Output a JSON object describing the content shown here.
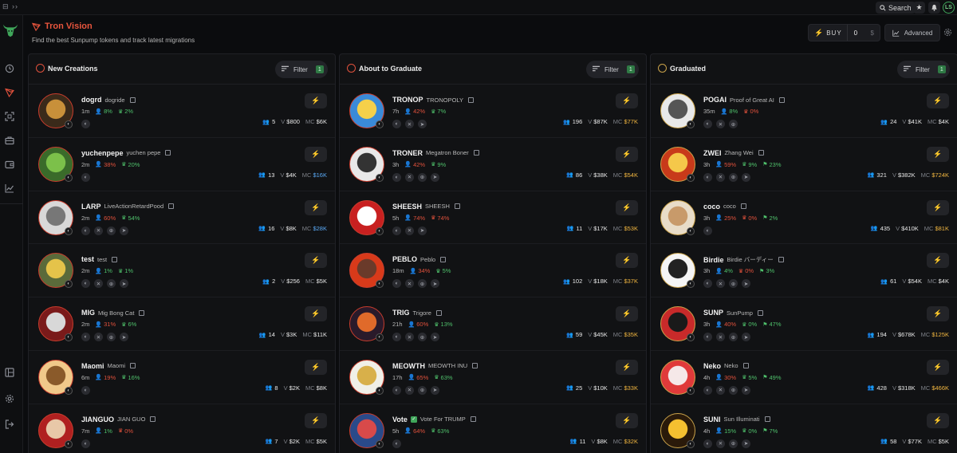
{
  "topbar": {
    "search_label": "Search",
    "avatar_initials": "LS"
  },
  "header": {
    "title": "Tron Vision",
    "subtitle": "Find the best Sunpump tokens and track latest migrations",
    "buy_label": "BUY",
    "buy_value": "0",
    "buy_unit": "$",
    "advanced_label": "Advanced"
  },
  "colors": {
    "accent": "#e0513c",
    "green": "#4fc06b",
    "mc_blue": "#5aa9f5",
    "mc_gold": "#f1b640"
  },
  "columns": [
    {
      "title": "New Creations",
      "filter_label": "Filter",
      "filter_count": "1",
      "tokens": [
        {
          "ticker": "dogrd",
          "name": "dogride",
          "age": "1m",
          "p1": "8%",
          "p1c": "green",
          "p2": "2%",
          "p2c": "green",
          "p3": "",
          "socials": [
            "web"
          ],
          "holders": "5",
          "volume": "$800",
          "mc": "$6K",
          "mcc": "white",
          "bg": "#3a2a1a",
          "fg": "#c8903a",
          "gold": false
        },
        {
          "ticker": "yuchenpepe",
          "name": "yuchen pepe",
          "age": "2m",
          "p1": "38%",
          "p1c": "red",
          "p2": "20%",
          "p2c": "green",
          "p3": "",
          "socials": [
            "web"
          ],
          "holders": "13",
          "volume": "$4K",
          "mc": "$16K",
          "mcc": "blue",
          "bg": "#3a6b2a",
          "fg": "#7cc04a",
          "gold": false
        },
        {
          "ticker": "LARP",
          "name": "LiveActionRetardPood",
          "age": "2m",
          "p1": "60%",
          "p1c": "red",
          "p2": "54%",
          "p2c": "green",
          "p3": "",
          "socials": [
            "web",
            "x",
            "globe",
            "tg"
          ],
          "holders": "16",
          "volume": "$8K",
          "mc": "$28K",
          "mcc": "blue",
          "bg": "#d8d8d8",
          "fg": "#777777",
          "gold": false
        },
        {
          "ticker": "test",
          "name": "test",
          "age": "2m",
          "p1": "1%",
          "p1c": "green",
          "p2": "1%",
          "p2c": "green",
          "p3": "",
          "socials": [
            "web",
            "x",
            "globe",
            "tg"
          ],
          "holders": "2",
          "volume": "$256",
          "mc": "$5K",
          "mcc": "white",
          "bg": "#5a6a3a",
          "fg": "#e5c34a",
          "gold": false
        },
        {
          "ticker": "MIG",
          "name": "Mig Bong Cat",
          "age": "2m",
          "p1": "31%",
          "p1c": "red",
          "p2": "6%",
          "p2c": "green",
          "p3": "",
          "socials": [
            "web",
            "x",
            "globe",
            "tg"
          ],
          "holders": "14",
          "volume": "$3K",
          "mc": "$11K",
          "mcc": "white",
          "bg": "#7a1a1a",
          "fg": "#d8d8d8",
          "gold": false
        },
        {
          "ticker": "Maomi",
          "name": "Maomi",
          "age": "6m",
          "p1": "19%",
          "p1c": "red",
          "p2": "16%",
          "p2c": "green",
          "p3": "",
          "socials": [
            "web"
          ],
          "holders": "8",
          "volume": "$2K",
          "mc": "$8K",
          "mcc": "white",
          "bg": "#f0c98a",
          "fg": "#8a5a2a",
          "gold": false
        },
        {
          "ticker": "JIANGUO",
          "name": "JIAN GUO",
          "age": "7m",
          "p1": "1%",
          "p1c": "green",
          "p2": "0%",
          "p2c": "red",
          "p3": "",
          "socials": [
            "web"
          ],
          "holders": "7",
          "volume": "$2K",
          "mc": "$5K",
          "mcc": "white",
          "bg": "#b02020",
          "fg": "#e8c8a8",
          "gold": false
        }
      ]
    },
    {
      "title": "About to Graduate",
      "filter_label": "Filter",
      "filter_count": "1",
      "tokens": [
        {
          "ticker": "TRONOP",
          "name": "TRONOPOLY",
          "age": "7h",
          "p1": "42%",
          "p1c": "red",
          "p2": "7%",
          "p2c": "green",
          "p3": "",
          "socials": [
            "web",
            "x",
            "tg"
          ],
          "holders": "196",
          "volume": "$87K",
          "mc": "$77K",
          "mcc": "gold",
          "bg": "#3a8ad8",
          "fg": "#f5d04a",
          "gold": false
        },
        {
          "ticker": "TRONER",
          "name": "Megatron Boner",
          "age": "3h",
          "p1": "42%",
          "p1c": "red",
          "p2": "9%",
          "p2c": "green",
          "p3": "",
          "socials": [
            "web",
            "x",
            "globe",
            "tg"
          ],
          "holders": "86",
          "volume": "$38K",
          "mc": "$54K",
          "mcc": "gold",
          "bg": "#e8e8e8",
          "fg": "#333333",
          "gold": false
        },
        {
          "ticker": "SHEESH",
          "name": "SHEESH",
          "age": "5h",
          "p1": "74%",
          "p1c": "red",
          "p2": "74%",
          "p2c": "red",
          "p3": "",
          "socials": [
            "web",
            "x",
            "tg"
          ],
          "holders": "11",
          "volume": "$17K",
          "mc": "$53K",
          "mcc": "gold",
          "bg": "#c82020",
          "fg": "#ffffff",
          "gold": false
        },
        {
          "ticker": "PEBLO",
          "name": "Peblo",
          "age": "18m",
          "p1": "34%",
          "p1c": "red",
          "p2": "5%",
          "p2c": "green",
          "p3": "",
          "socials": [
            "web",
            "x",
            "globe",
            "tg"
          ],
          "holders": "102",
          "volume": "$18K",
          "mc": "$37K",
          "mcc": "gold",
          "bg": "#d83a1a",
          "fg": "#6a3a2a",
          "gold": false
        },
        {
          "ticker": "TRIG",
          "name": "Trigore",
          "age": "21h",
          "p1": "60%",
          "p1c": "red",
          "p2": "13%",
          "p2c": "green",
          "p3": "",
          "socials": [
            "web",
            "x",
            "globe",
            "tg"
          ],
          "holders": "59",
          "volume": "$45K",
          "mc": "$35K",
          "mcc": "gold",
          "bg": "#2a1a2a",
          "fg": "#e06a2a",
          "gold": false
        },
        {
          "ticker": "MEOWTH",
          "name": "MEOWTH INU",
          "age": "17h",
          "p1": "65%",
          "p1c": "red",
          "p2": "63%",
          "p2c": "green",
          "p3": "",
          "socials": [
            "web",
            "x",
            "globe",
            "tg"
          ],
          "holders": "25",
          "volume": "$10K",
          "mc": "$33K",
          "mcc": "gold",
          "bg": "#f0f0e8",
          "fg": "#d8b04a",
          "gold": false
        },
        {
          "ticker": "Vote",
          "name": "Vote For TRUMP",
          "verified": true,
          "age": "5h",
          "p1": "64%",
          "p1c": "red",
          "p2": "63%",
          "p2c": "green",
          "p3": "",
          "socials": [
            "web"
          ],
          "holders": "11",
          "volume": "$8K",
          "mc": "$32K",
          "mcc": "gold",
          "bg": "#2a4a8a",
          "fg": "#d84a4a",
          "gold": false
        }
      ]
    },
    {
      "title": "Graduated",
      "filter_label": "Filter",
      "filter_count": "1",
      "tokens": [
        {
          "ticker": "POGAI",
          "name": "Proof of Great AI",
          "age": "35m",
          "p1": "8%",
          "p1c": "green",
          "p2": "0%",
          "p2c": "red",
          "p3": "",
          "socials": [
            "web",
            "x",
            "globe"
          ],
          "holders": "24",
          "volume": "$41K",
          "mc": "$4K",
          "mcc": "white",
          "bg": "#e8e8e8",
          "fg": "#555555",
          "gold": true
        },
        {
          "ticker": "ZWEI",
          "name": "Zhang Wei",
          "age": "3h",
          "p1": "59%",
          "p1c": "red",
          "p2": "9%",
          "p2c": "green",
          "p3": "23%",
          "socials": [
            "web",
            "x",
            "globe",
            "tg"
          ],
          "holders": "321",
          "volume": "$382K",
          "mc": "$724K",
          "mcc": "gold",
          "bg": "#c83a1a",
          "fg": "#f5c84a",
          "gold": true
        },
        {
          "ticker": "coco",
          "name": "coco",
          "age": "3h",
          "p1": "25%",
          "p1c": "red",
          "p2": "0%",
          "p2c": "red",
          "p3": "2%",
          "socials": [
            "web"
          ],
          "holders": "435",
          "volume": "$410K",
          "mc": "$81K",
          "mcc": "gold",
          "bg": "#e8dcc8",
          "fg": "#c89a6a",
          "gold": true
        },
        {
          "ticker": "Birdie",
          "name": "Birdie バーディー",
          "age": "3h",
          "p1": "4%",
          "p1c": "green",
          "p2": "0%",
          "p2c": "red",
          "p3": "3%",
          "socials": [
            "web",
            "x",
            "globe",
            "tg"
          ],
          "holders": "61",
          "volume": "$54K",
          "mc": "$4K",
          "mcc": "white",
          "bg": "#f5f5f5",
          "fg": "#222222",
          "gold": true
        },
        {
          "ticker": "SUNP",
          "name": "SunPump",
          "age": "3h",
          "p1": "40%",
          "p1c": "red",
          "p2": "0%",
          "p2c": "green",
          "p3": "47%",
          "socials": [
            "web",
            "x",
            "globe",
            "tg"
          ],
          "holders": "194",
          "volume": "$678K",
          "mc": "$125K",
          "mcc": "gold",
          "bg": "#c82a2a",
          "fg": "#1a1a1a",
          "gold": true
        },
        {
          "ticker": "Neko",
          "name": "Neko",
          "age": "4h",
          "p1": "30%",
          "p1c": "red",
          "p2": "5%",
          "p2c": "green",
          "p3": "49%",
          "socials": [
            "web",
            "x",
            "globe",
            "tg"
          ],
          "holders": "428",
          "volume": "$318K",
          "mc": "$466K",
          "mcc": "gold",
          "bg": "#e03a3a",
          "fg": "#f5e8e8",
          "gold": true
        },
        {
          "ticker": "SUNI",
          "name": "Sun Illuminati",
          "age": "4h",
          "p1": "15%",
          "p1c": "green",
          "p2": "0%",
          "p2c": "green",
          "p3": "7%",
          "socials": [
            "web",
            "x",
            "globe",
            "tg"
          ],
          "holders": "58",
          "volume": "$77K",
          "mc": "$5K",
          "mcc": "white",
          "bg": "#2a1a0a",
          "fg": "#f5c030",
          "gold": true
        }
      ]
    }
  ]
}
